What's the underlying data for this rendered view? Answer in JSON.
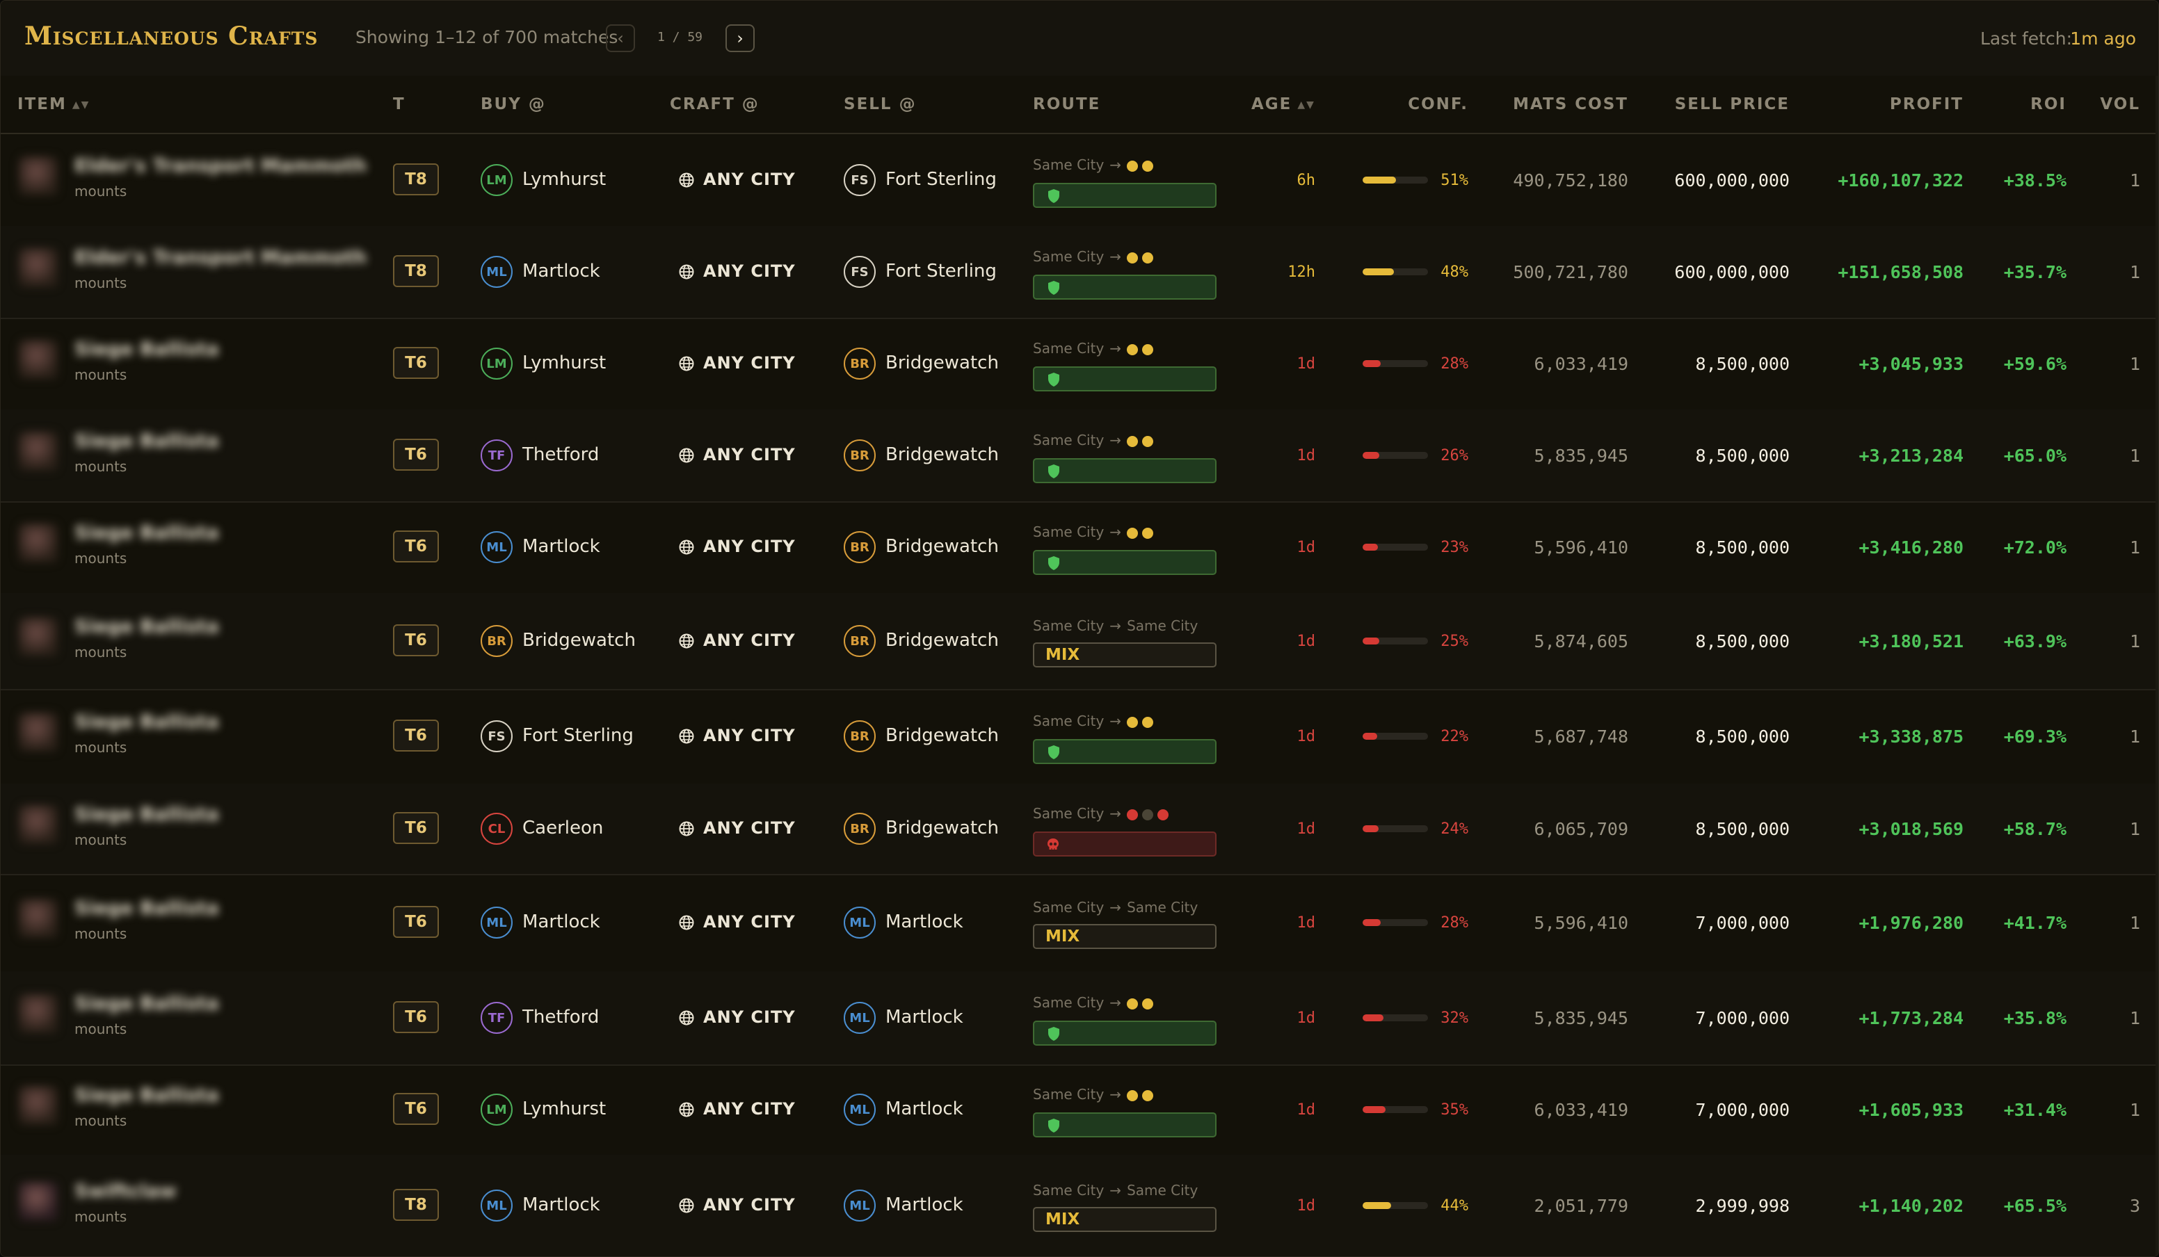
{
  "header": {
    "title": "Miscellaneous Crafts",
    "showing": "Showing 1–12 of 700 matches",
    "prev_icon": "‹",
    "next_icon": "›",
    "page_text": "1 / 59",
    "fetch_label": "Last fetch:",
    "fetch_value": "1m ago"
  },
  "columns": {
    "item": "ITEM",
    "tier": "T",
    "buy": "BUY @",
    "craft": "CRAFT @",
    "sell": "SELL @",
    "route": "ROUTE",
    "age": "AGE",
    "conf": "CONF.",
    "mats": "MATS COST",
    "sell_price": "SELL PRICE",
    "profit": "PROFIT",
    "roi": "ROI",
    "vol": "VOL"
  },
  "colors": {
    "accent": "#e0b54a",
    "profit_green": "#4fc45a",
    "warn_yellow": "#e6bb3a",
    "danger_red": "#d8453f"
  },
  "city_badges": {
    "LM": {
      "name": "Lymhurst",
      "color": "#4cae5a"
    },
    "ML": {
      "name": "Martlock",
      "color": "#4a8ed0"
    },
    "FS": {
      "name": "Fort Sterling",
      "color": "#d8d2c4"
    },
    "BR": {
      "name": "Bridgewatch",
      "color": "#d89c3a"
    },
    "TF": {
      "name": "Thetford",
      "color": "#9a6ad0"
    },
    "CL": {
      "name": "Caerleon",
      "color": "#d8453f"
    }
  },
  "rows": [
    {
      "name": "Elder's Transport Mammoth",
      "cat": "mounts",
      "tier": "T8",
      "buy_code": "LM",
      "buy": "Lymhurst",
      "craft": "ANY CITY",
      "sell_code": "FS",
      "sell": "Fort Sterling",
      "route_from": "Same City",
      "route_to": "",
      "route_dots": "yy",
      "route_kind": "safe",
      "age": "6h",
      "conf": "51%",
      "conf_frac": 0.51,
      "mats": "490,752,180",
      "sell_price": "600,000,000",
      "profit": "+160,107,322",
      "roi": "+38.5%",
      "vol": "1"
    },
    {
      "name": "Elder's Transport Mammoth",
      "cat": "mounts",
      "tier": "T8",
      "buy_code": "ML",
      "buy": "Martlock",
      "craft": "ANY CITY",
      "sell_code": "FS",
      "sell": "Fort Sterling",
      "route_from": "Same City",
      "route_to": "",
      "route_dots": "yy",
      "route_kind": "safe",
      "age": "12h",
      "conf": "48%",
      "conf_frac": 0.48,
      "mats": "500,721,780",
      "sell_price": "600,000,000",
      "profit": "+151,658,508",
      "roi": "+35.7%",
      "vol": "1"
    },
    {
      "name": "Siege Ballista",
      "cat": "mounts",
      "tier": "T6",
      "buy_code": "LM",
      "buy": "Lymhurst",
      "craft": "ANY CITY",
      "sell_code": "BR",
      "sell": "Bridgewatch",
      "route_from": "Same City",
      "route_to": "",
      "route_dots": "yy",
      "route_kind": "safe",
      "age": "1d",
      "conf": "28%",
      "conf_frac": 0.28,
      "mats": "6,033,419",
      "sell_price": "8,500,000",
      "profit": "+3,045,933",
      "roi": "+59.6%",
      "vol": "1"
    },
    {
      "name": "Siege Ballista",
      "cat": "mounts",
      "tier": "T6",
      "buy_code": "TF",
      "buy": "Thetford",
      "craft": "ANY CITY",
      "sell_code": "BR",
      "sell": "Bridgewatch",
      "route_from": "Same City",
      "route_to": "",
      "route_dots": "yy",
      "route_kind": "safe",
      "age": "1d",
      "conf": "26%",
      "conf_frac": 0.26,
      "mats": "5,835,945",
      "sell_price": "8,500,000",
      "profit": "+3,213,284",
      "roi": "+65.0%",
      "vol": "1"
    },
    {
      "name": "Siege Ballista",
      "cat": "mounts",
      "tier": "T6",
      "buy_code": "ML",
      "buy": "Martlock",
      "craft": "ANY CITY",
      "sell_code": "BR",
      "sell": "Bridgewatch",
      "route_from": "Same City",
      "route_to": "",
      "route_dots": "yy",
      "route_kind": "safe",
      "age": "1d",
      "conf": "23%",
      "conf_frac": 0.23,
      "mats": "5,596,410",
      "sell_price": "8,500,000",
      "profit": "+3,416,280",
      "roi": "+72.0%",
      "vol": "1"
    },
    {
      "name": "Siege Ballista",
      "cat": "mounts",
      "tier": "T6",
      "buy_code": "BR",
      "buy": "Bridgewatch",
      "craft": "ANY CITY",
      "sell_code": "BR",
      "sell": "Bridgewatch",
      "route_from": "Same City",
      "route_to": "Same City",
      "route_dots": "",
      "route_kind": "mix",
      "route_label": "MIX",
      "age": "1d",
      "conf": "25%",
      "conf_frac": 0.25,
      "mats": "5,874,605",
      "sell_price": "8,500,000",
      "profit": "+3,180,521",
      "roi": "+63.9%",
      "vol": "1"
    },
    {
      "name": "Siege Ballista",
      "cat": "mounts",
      "tier": "T6",
      "buy_code": "FS",
      "buy": "Fort Sterling",
      "craft": "ANY CITY",
      "sell_code": "BR",
      "sell": "Bridgewatch",
      "route_from": "Same City",
      "route_to": "",
      "route_dots": "yy",
      "route_kind": "safe",
      "age": "1d",
      "conf": "22%",
      "conf_frac": 0.22,
      "mats": "5,687,748",
      "sell_price": "8,500,000",
      "profit": "+3,338,875",
      "roi": "+69.3%",
      "vol": "1"
    },
    {
      "name": "Siege Ballista",
      "cat": "mounts",
      "tier": "T6",
      "buy_code": "CL",
      "buy": "Caerleon",
      "craft": "ANY CITY",
      "sell_code": "BR",
      "sell": "Bridgewatch",
      "route_from": "Same City",
      "route_to": "",
      "route_dots": "rgr",
      "route_kind": "danger",
      "age": "1d",
      "conf": "24%",
      "conf_frac": 0.24,
      "mats": "6,065,709",
      "sell_price": "8,500,000",
      "profit": "+3,018,569",
      "roi": "+58.7%",
      "vol": "1"
    },
    {
      "name": "Siege Ballista",
      "cat": "mounts",
      "tier": "T6",
      "buy_code": "ML",
      "buy": "Martlock",
      "craft": "ANY CITY",
      "sell_code": "ML",
      "sell": "Martlock",
      "route_from": "Same City",
      "route_to": "Same City",
      "route_dots": "",
      "route_kind": "mix",
      "route_label": "MIX",
      "age": "1d",
      "conf": "28%",
      "conf_frac": 0.28,
      "mats": "5,596,410",
      "sell_price": "7,000,000",
      "profit": "+1,976,280",
      "roi": "+41.7%",
      "vol": "1"
    },
    {
      "name": "Siege Ballista",
      "cat": "mounts",
      "tier": "T6",
      "buy_code": "TF",
      "buy": "Thetford",
      "craft": "ANY CITY",
      "sell_code": "ML",
      "sell": "Martlock",
      "route_from": "Same City",
      "route_to": "",
      "route_dots": "yy",
      "route_kind": "safe",
      "age": "1d",
      "conf": "32%",
      "conf_frac": 0.32,
      "mats": "5,835,945",
      "sell_price": "7,000,000",
      "profit": "+1,773,284",
      "roi": "+35.8%",
      "vol": "1"
    },
    {
      "name": "Siege Ballista",
      "cat": "mounts",
      "tier": "T6",
      "buy_code": "LM",
      "buy": "Lymhurst",
      "craft": "ANY CITY",
      "sell_code": "ML",
      "sell": "Martlock",
      "route_from": "Same City",
      "route_to": "",
      "route_dots": "yy",
      "route_kind": "safe",
      "age": "1d",
      "conf": "35%",
      "conf_frac": 0.35,
      "mats": "6,033,419",
      "sell_price": "7,000,000",
      "profit": "+1,605,933",
      "roi": "+31.4%",
      "vol": "1"
    },
    {
      "name": "Swiftclaw",
      "cat": "mounts",
      "tier": "T8",
      "buy_code": "ML",
      "buy": "Martlock",
      "craft": "ANY CITY",
      "sell_code": "ML",
      "sell": "Martlock",
      "route_from": "Same City",
      "route_to": "Same City",
      "route_dots": "",
      "route_kind": "mix",
      "route_label": "MIX",
      "age": "1d",
      "conf": "44%",
      "conf_frac": 0.44,
      "mats": "2,051,779",
      "sell_price": "2,999,998",
      "profit": "+1,140,202",
      "roi": "+65.5%",
      "vol": "3"
    }
  ]
}
